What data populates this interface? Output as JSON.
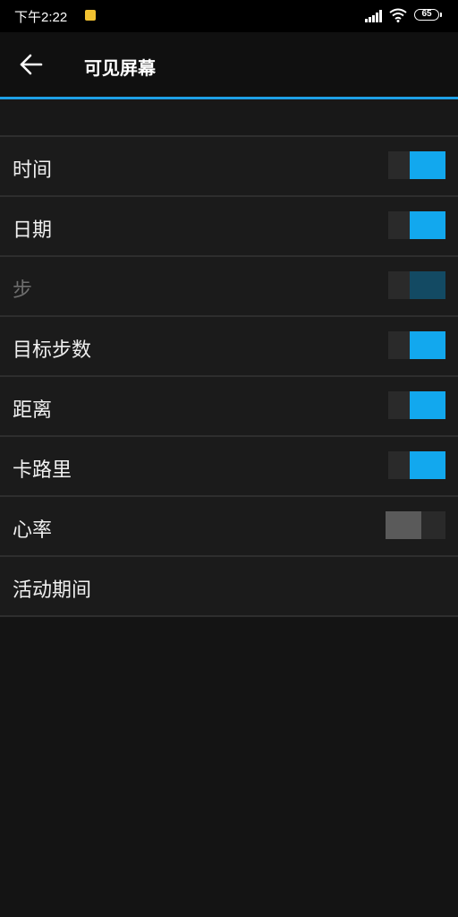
{
  "status_bar": {
    "time": "下午2:22",
    "battery": "65",
    "icons": [
      "notification-icon",
      "signal-icon",
      "wifi-icon",
      "battery-icon"
    ]
  },
  "header": {
    "title": "可见屏幕",
    "back_icon": "arrow-left-icon"
  },
  "colors": {
    "accent": "#12a8ee",
    "accent_disabled": "#134a63",
    "toggle_off_thumb": "#5a5a5a",
    "accent_line": "#1ea0e6"
  },
  "settings": {
    "items": [
      {
        "label": "时间",
        "toggle": "on",
        "enabled": true
      },
      {
        "label": "日期",
        "toggle": "on",
        "enabled": true
      },
      {
        "label": "步",
        "toggle": "on",
        "enabled": false
      },
      {
        "label": "目标步数",
        "toggle": "on",
        "enabled": true
      },
      {
        "label": "距离",
        "toggle": "on",
        "enabled": true
      },
      {
        "label": "卡路里",
        "toggle": "on",
        "enabled": true
      },
      {
        "label": "心率",
        "toggle": "off",
        "enabled": true
      },
      {
        "label": "活动期间",
        "toggle": null,
        "enabled": true
      }
    ]
  }
}
